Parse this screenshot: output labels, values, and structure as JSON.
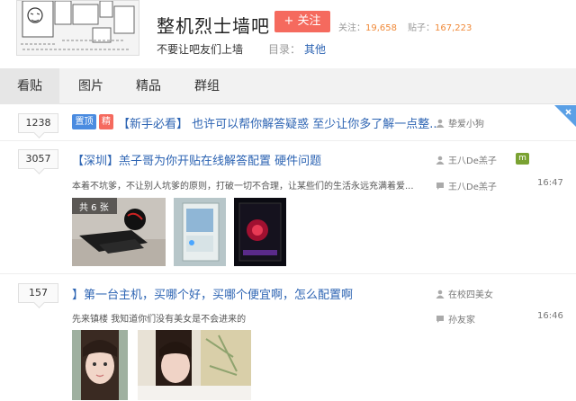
{
  "forum": {
    "title": "整机烈士墙吧",
    "follow_label": "+ 关注",
    "follow_stat_label": "关注：",
    "follow_count": "19,658",
    "post_stat_label": "贴子：",
    "post_count": "167,223",
    "slogan": "不要让吧友们上墙",
    "catalog_label": "目录：",
    "catalog_value": "其他"
  },
  "tabs": [
    "看贴",
    "图片",
    "精品",
    "群组"
  ],
  "threads": [
    {
      "reply_count": "1238",
      "tags": [
        "置顶",
        "精"
      ],
      "title": "【新手必看】 也许可以帮你解答疑惑 至少让你多了解一点整...",
      "author": "挚爱小狗"
    },
    {
      "reply_count": "3057",
      "title": "【深圳】羔子哥为你开贴在线解答配置 硬件问题",
      "author": "王八De羔子",
      "abstract": "本着不坑爹，不让别人坑爹的原则，打破一切不合理，让某些们的生活永远充满着爱...",
      "last_reply_author": "王八De羔子",
      "time": "16:47",
      "image_count": "共 6 张"
    },
    {
      "reply_count": "157",
      "title": "】第一台主机，买哪个好，买哪个便宜啊，怎么配置啊",
      "author": "在校四美女",
      "abstract": "先来镇楼 我知道你们没有美女是不会进来的",
      "last_reply_author": "孙友家",
      "time": "16:46"
    }
  ],
  "colors": {
    "link": "#2d64b3",
    "follow_button": "#f56a5e",
    "stat_number": "#f08a3a",
    "tag_top": "#4a8be0",
    "tag_good": "#f56a5e"
  }
}
